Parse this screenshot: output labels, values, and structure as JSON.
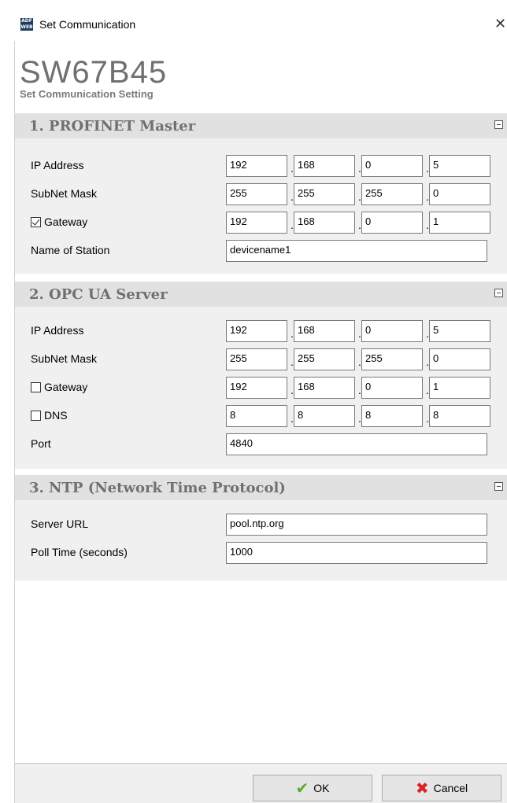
{
  "window": {
    "title": "Set Communication",
    "close_glyph": "✕",
    "app_icon_top": "ADF",
    "app_icon_bottom": "WEB"
  },
  "header": {
    "device": "SW67B45",
    "subtitle": "Set Communication Setting"
  },
  "sections": {
    "profinet": {
      "title": "1. PROFINET Master",
      "ip_label": "IP Address",
      "ip": [
        "192",
        "168",
        "0",
        "5"
      ],
      "mask_label": "SubNet Mask",
      "mask": [
        "255",
        "255",
        "255",
        "0"
      ],
      "gateway_label": "Gateway",
      "gateway_checked": true,
      "gateway": [
        "192",
        "168",
        "0",
        "1"
      ],
      "station_label": "Name of Station",
      "station": "devicename1"
    },
    "opcua": {
      "title": "2. OPC UA Server",
      "ip_label": "IP Address",
      "ip": [
        "192",
        "168",
        "0",
        "5"
      ],
      "mask_label": "SubNet Mask",
      "mask": [
        "255",
        "255",
        "255",
        "0"
      ],
      "gateway_label": "Gateway",
      "gateway_checked": false,
      "gateway": [
        "192",
        "168",
        "0",
        "1"
      ],
      "dns_label": "DNS",
      "dns_checked": false,
      "dns": [
        "8",
        "8",
        "8",
        "8"
      ],
      "port_label": "Port",
      "port": "4840"
    },
    "ntp": {
      "title": "3. NTP (Network Time Protocol)",
      "url_label": "Server URL",
      "url": "pool.ntp.org",
      "poll_label": "Poll Time (seconds)",
      "poll": "1000"
    }
  },
  "footer": {
    "ok_label": "OK",
    "cancel_label": "Cancel"
  },
  "icons": {
    "collapse": "collapse-icon",
    "ok": "checkmark-icon",
    "cancel": "cross-icon"
  },
  "colors": {
    "section_bar": "#e1e1e1",
    "section_body": "#f0f0f0",
    "title_gray": "#707070"
  }
}
